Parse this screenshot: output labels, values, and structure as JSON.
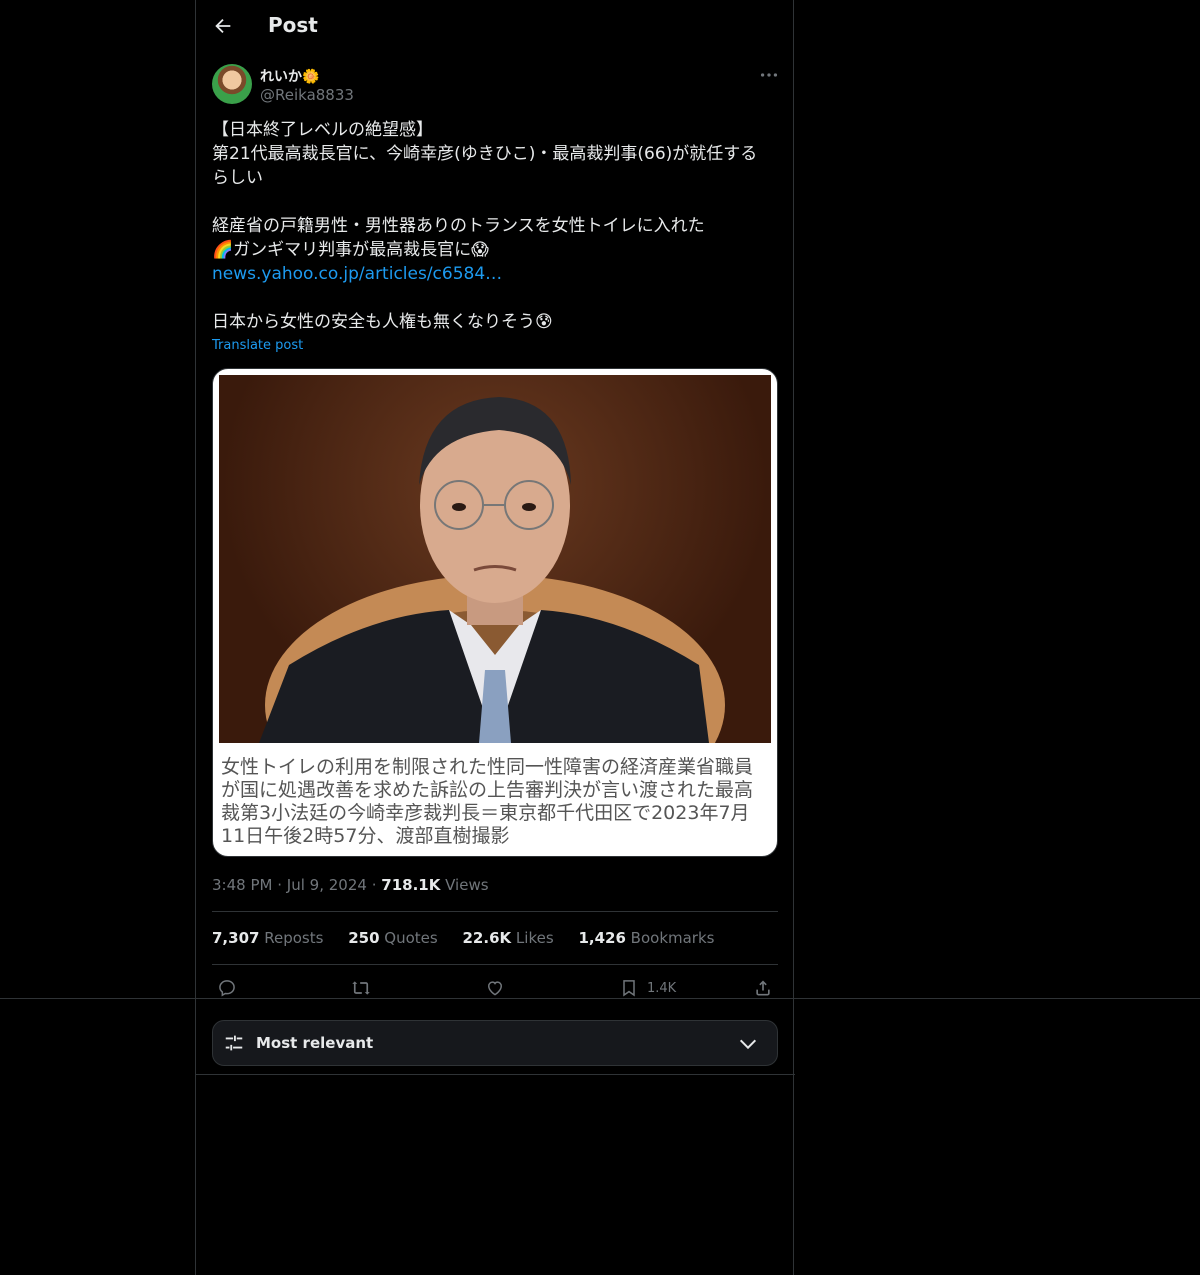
{
  "header": {
    "title": "Post"
  },
  "author": {
    "name": "れいか",
    "name_emoji": "🌼",
    "handle": "@Reika8833"
  },
  "post": {
    "line1": "【日本終了レベルの絶望感】",
    "line2": "第21代最高裁長官に、今崎幸彦(ゆきひこ)・最高裁判事(66)が就任するらしい",
    "line3": "経産省の戸籍男性・男性器ありのトランスを女性トイレに入れた",
    "line4": "🌈ガンギマリ判事が最高裁長官に😱",
    "link": "news.yahoo.co.jp/articles/c6584…",
    "line5": "日本から女性の安全も人権も無くなりそう😰",
    "translate": "Translate post"
  },
  "media": {
    "caption": "女性トイレの利用を制限された性同一性障害の経済産業省職員が国に処遇改善を求めた訴訟の上告審判決が言い渡された最高裁第3小法廷の今崎幸彦裁判長＝東京都千代田区で2023年7月11日午後2時57分、渡部直樹撮影"
  },
  "meta": {
    "time": "3:48 PM",
    "date": "Jul 9, 2024",
    "views_count": "718.1K",
    "views_label": "Views",
    "sep": "·"
  },
  "stats": {
    "reposts_count": "7,307",
    "reposts_label": "Reposts",
    "quotes_count": "250",
    "quotes_label": "Quotes",
    "likes_count": "22.6K",
    "likes_label": "Likes",
    "bookmarks_count": "1,426",
    "bookmarks_label": "Bookmarks"
  },
  "actions": {
    "bookmark_count": "1.4K"
  },
  "sort": {
    "label": "Most relevant"
  },
  "colors": {
    "accent": "#1d9bf0",
    "muted": "#71767b",
    "border": "#2f3336",
    "background": "#000000"
  }
}
